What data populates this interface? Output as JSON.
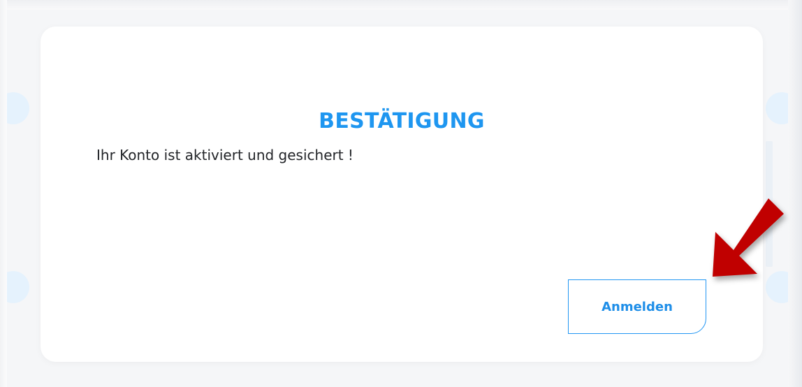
{
  "dialog": {
    "title": "BESTÄTIGUNG",
    "message": "Ihr Konto ist aktiviert und gesichert !",
    "login_button_label": "Anmelden"
  },
  "colors": {
    "accent": "#1e96f0",
    "text": "#222428",
    "annotation_arrow": "#c00000",
    "backdrop": "#f5f6f8"
  },
  "annotation": {
    "icon": "red-arrow-icon",
    "points_to": "login-button"
  }
}
